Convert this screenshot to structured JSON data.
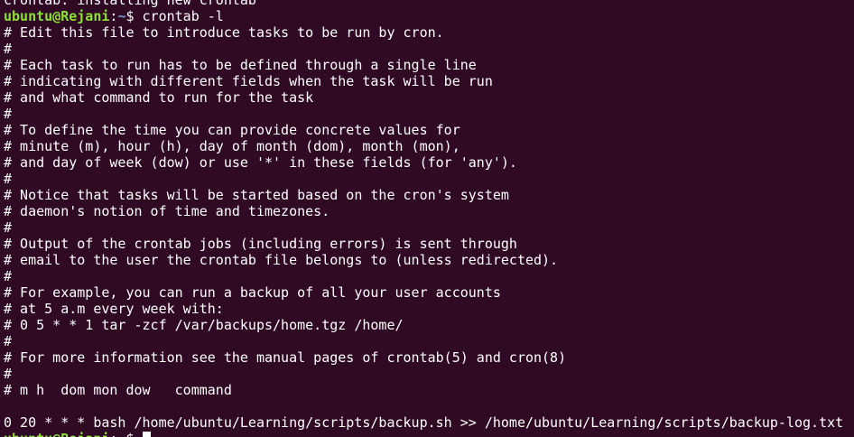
{
  "terminal": {
    "background": "#300a24",
    "user_color": "#8ae234",
    "path_color": "#729fcf",
    "status_line": "crontab: installing new crontab",
    "prompt": {
      "user_host": "ubuntu@Rejani",
      "sep": ":",
      "path": "~",
      "symbol": "$ "
    },
    "command": "crontab -l",
    "output_lines": [
      "# Edit this file to introduce tasks to be run by cron.",
      "#",
      "# Each task to run has to be defined through a single line",
      "# indicating with different fields when the task will be run",
      "# and what command to run for the task",
      "#",
      "# To define the time you can provide concrete values for",
      "# minute (m), hour (h), day of month (dom), month (mon),",
      "# and day of week (dow) or use '*' in these fields (for 'any').",
      "#",
      "# Notice that tasks will be started based on the cron's system",
      "# daemon's notion of time and timezones.",
      "#",
      "# Output of the crontab jobs (including errors) is sent through",
      "# email to the user the crontab file belongs to (unless redirected).",
      "#",
      "# For example, you can run a backup of all your user accounts",
      "# at 5 a.m every week with:",
      "# 0 5 * * 1 tar -zcf /var/backups/home.tgz /home/",
      "#",
      "# For more information see the manual pages of crontab(5) and cron(8)",
      "#",
      "# m h  dom mon dow   command",
      "",
      "0 20 * * * bash /home/ubuntu/Learning/scripts/backup.sh >> /home/ubuntu/Learning/scripts/backup-log.txt"
    ]
  }
}
